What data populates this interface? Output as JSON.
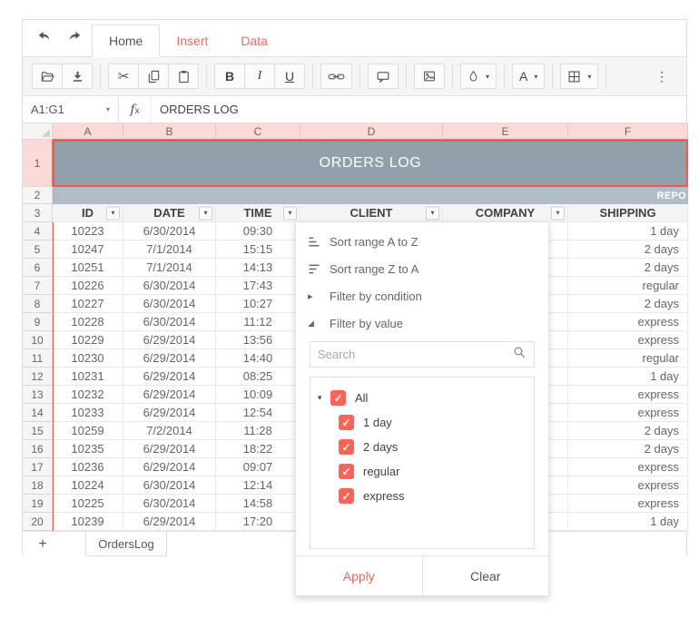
{
  "colors": {
    "primary": "#ff6358",
    "selection_border": "#f4584e",
    "title_fill": "#92a0ab",
    "subtitle_fill": "#b0bcc6",
    "header_pink": "#fbdad7"
  },
  "ribbon": {
    "tabs": [
      {
        "label": "Home",
        "active": true
      },
      {
        "label": "Insert",
        "active": false
      },
      {
        "label": "Data",
        "active": false
      }
    ]
  },
  "toolbar": {
    "items": [
      {
        "type": "button",
        "name": "open-button",
        "glyph": "folder"
      },
      {
        "type": "button",
        "name": "export-button",
        "glyph": "download"
      },
      {
        "type": "sep"
      },
      {
        "type": "button",
        "name": "cut-button",
        "glyph": "scissors"
      },
      {
        "type": "button",
        "name": "copy-button",
        "glyph": "copy"
      },
      {
        "type": "button",
        "name": "paste-button",
        "glyph": "paste"
      },
      {
        "type": "sep"
      },
      {
        "type": "button",
        "name": "bold-button",
        "label": "B",
        "text_style": "lb-bold"
      },
      {
        "type": "button",
        "name": "italic-button",
        "label": "I",
        "text_style": "lb-italic"
      },
      {
        "type": "button",
        "name": "underline-button",
        "label": "U",
        "text_style": "lb-underline"
      },
      {
        "type": "sep"
      },
      {
        "type": "button",
        "name": "link-button",
        "glyph": "link"
      },
      {
        "type": "sep"
      },
      {
        "type": "button",
        "name": "comment-button",
        "glyph": "comment"
      },
      {
        "type": "sep"
      },
      {
        "type": "button",
        "name": "image-button",
        "glyph": "image"
      },
      {
        "type": "sep"
      },
      {
        "type": "dropdown",
        "name": "fill-color-button",
        "glyph": "droplet"
      },
      {
        "type": "sep"
      },
      {
        "type": "dropdown",
        "name": "font-color-button",
        "label": "A"
      },
      {
        "type": "sep"
      },
      {
        "type": "dropdown",
        "name": "borders-button",
        "glyph": "grid"
      },
      {
        "type": "sep"
      },
      {
        "type": "more",
        "name": "overflow-button",
        "label": "⋮"
      }
    ]
  },
  "formula_bar": {
    "name_box": "A1:G1",
    "fx_f": "f",
    "fx_x": "x",
    "value": "ORDERS LOG"
  },
  "sheet": {
    "column_headers": [
      "A",
      "B",
      "C",
      "D",
      "E",
      "F"
    ],
    "title_row": {
      "number": "1",
      "text": "ORDERS LOG"
    },
    "subtitle_row": {
      "number": "2",
      "text": "REPO"
    },
    "header_row": {
      "number": "3",
      "cells": [
        "ID",
        "DATE",
        "TIME",
        "CLIENT",
        "COMPANY",
        "SHIPPING"
      ],
      "filter_buttons": [
        true,
        true,
        true,
        true,
        true,
        false
      ]
    },
    "rows": [
      {
        "n": "4",
        "id": "10223",
        "date": "6/30/2014",
        "time": "09:30",
        "shipping": "1 day"
      },
      {
        "n": "5",
        "id": "10247",
        "date": "7/1/2014",
        "time": "15:15",
        "shipping": "2 days"
      },
      {
        "n": "6",
        "id": "10251",
        "date": "7/1/2014",
        "time": "14:13",
        "shipping": "2 days"
      },
      {
        "n": "7",
        "id": "10226",
        "date": "6/30/2014",
        "time": "17:43",
        "shipping": "regular"
      },
      {
        "n": "8",
        "id": "10227",
        "date": "6/30/2014",
        "time": "10:27",
        "shipping": "2 days"
      },
      {
        "n": "9",
        "id": "10228",
        "date": "6/30/2014",
        "time": "11:12",
        "shipping": "express"
      },
      {
        "n": "10",
        "id": "10229",
        "date": "6/29/2014",
        "time": "13:56",
        "shipping": "express"
      },
      {
        "n": "11",
        "id": "10230",
        "date": "6/29/2014",
        "time": "14:40",
        "shipping": "regular"
      },
      {
        "n": "12",
        "id": "10231",
        "date": "6/29/2014",
        "time": "08:25",
        "shipping": "1 day"
      },
      {
        "n": "13",
        "id": "10232",
        "date": "6/29/2014",
        "time": "10:09",
        "shipping": "express"
      },
      {
        "n": "14",
        "id": "10233",
        "date": "6/29/2014",
        "time": "12:54",
        "shipping": "express"
      },
      {
        "n": "15",
        "id": "10259",
        "date": "7/2/2014",
        "time": "11:28",
        "shipping": "2 days"
      },
      {
        "n": "16",
        "id": "10235",
        "date": "6/29/2014",
        "time": "18:22",
        "shipping": "2 days"
      },
      {
        "n": "17",
        "id": "10236",
        "date": "6/29/2014",
        "time": "09:07",
        "shipping": "express"
      },
      {
        "n": "18",
        "id": "10224",
        "date": "6/30/2014",
        "time": "12:14",
        "shipping": "express"
      },
      {
        "n": "19",
        "id": "10225",
        "date": "6/30/2014",
        "time": "14:58",
        "shipping": "express"
      },
      {
        "n": "20",
        "id": "10239",
        "date": "6/29/2014",
        "time": "17:20",
        "shipping": "1 day"
      }
    ]
  },
  "filter_menu": {
    "items": [
      {
        "icon": "sort-asc",
        "label": "Sort range A to Z"
      },
      {
        "icon": "sort-desc",
        "label": "Sort range Z to A"
      },
      {
        "icon": "caret-right",
        "label": "Filter by condition"
      },
      {
        "icon": "caret-expanded",
        "label": "Filter by value"
      }
    ],
    "search_placeholder": "Search",
    "tree": {
      "parent": {
        "label": "All",
        "checked": true
      },
      "children": [
        {
          "label": "1 day",
          "checked": true
        },
        {
          "label": "2 days",
          "checked": true
        },
        {
          "label": "regular",
          "checked": true
        },
        {
          "label": "express",
          "checked": true
        }
      ]
    },
    "apply_label": "Apply",
    "clear_label": "Clear"
  },
  "sheet_bar": {
    "add_label": "+",
    "tabs": [
      {
        "label": "OrdersLog",
        "active": true
      }
    ]
  }
}
